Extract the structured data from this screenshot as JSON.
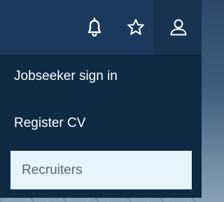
{
  "header": {
    "icons": {
      "notifications": "bell-icon",
      "favorites": "star-icon",
      "account": "user-icon"
    }
  },
  "account_menu": {
    "items": [
      {
        "label": "Jobseeker sign in"
      },
      {
        "label": "Register CV"
      },
      {
        "label": "Recruiters",
        "selected": true
      }
    ]
  },
  "colors": {
    "header_bg": "#193a5c",
    "menu_bg": "#0f2a45",
    "highlight_bg": "#e6f4ff",
    "highlight_text": "#5b6774",
    "text": "#ffffff"
  }
}
